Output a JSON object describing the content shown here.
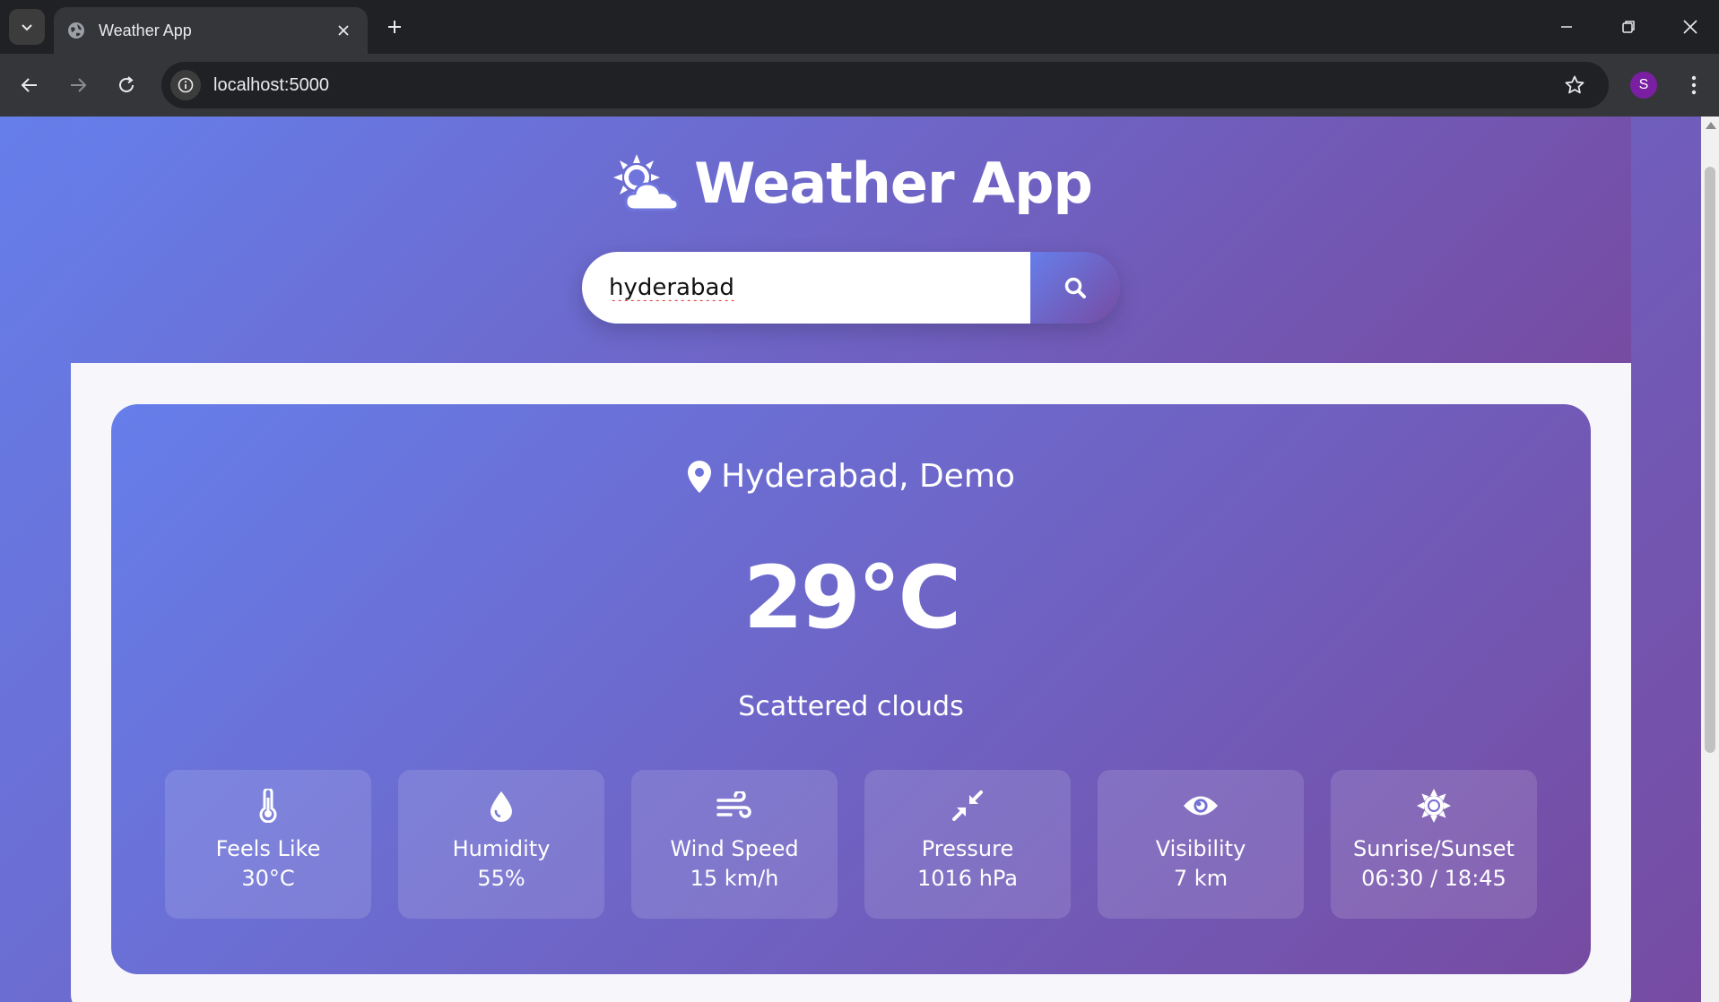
{
  "browser": {
    "tab_title": "Weather App",
    "url": "localhost:5000",
    "profile_initial": "S"
  },
  "app": {
    "title": "Weather App",
    "search_value": "hyderabad"
  },
  "weather": {
    "location": "Hyderabad, Demo",
    "temperature": "29°C",
    "description": "Scattered clouds",
    "details": [
      {
        "icon": "thermometer-icon",
        "label": "Feels Like",
        "value": "30°C"
      },
      {
        "icon": "water-drop-icon",
        "label": "Humidity",
        "value": "55%"
      },
      {
        "icon": "wind-icon",
        "label": "Wind Speed",
        "value": "15 km/h"
      },
      {
        "icon": "compress-arrows-icon",
        "label": "Pressure",
        "value": "1016 hPa"
      },
      {
        "icon": "eye-icon",
        "label": "Visibility",
        "value": "7 km"
      },
      {
        "icon": "sun-icon",
        "label": "Sunrise/Sunset",
        "value": "06:30 / 18:45"
      }
    ]
  },
  "colors": {
    "gradient_start": "#667eea",
    "gradient_end": "#764ba2",
    "content_background": "#f7f6fb"
  }
}
